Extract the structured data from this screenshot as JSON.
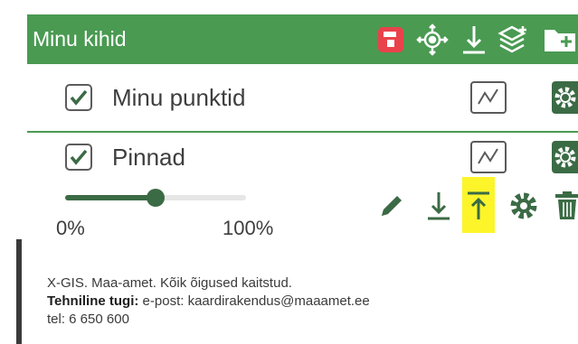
{
  "header": {
    "title": "Minu kihid",
    "icons": [
      "save-icon",
      "locate-icon",
      "download-icon",
      "add-layer-icon",
      "add-folder-icon"
    ],
    "colors": {
      "background": "#4a9a52",
      "save_accent": "#e9424b"
    }
  },
  "layers": [
    {
      "label": "Minu punktid",
      "checked": true
    },
    {
      "label": "Pinnad",
      "checked": true
    }
  ],
  "opacity_slider": {
    "min_label": "0%",
    "max_label": "100%",
    "value": 0.5
  },
  "layer_tools": [
    "edit-icon",
    "download-icon",
    "upload-icon",
    "settings-icon",
    "delete-icon"
  ],
  "footer": {
    "copyright": "X-GIS. Maa-amet. Kõik õigused kaitstud.",
    "support_label": "Tehniline tugi:",
    "support_text": " e-post: kaardirakendus@maaamet.ee",
    "phone": "tel: 6 650 600"
  },
  "accent_color": "#3b6b45",
  "highlight_color": "#fdf52a"
}
